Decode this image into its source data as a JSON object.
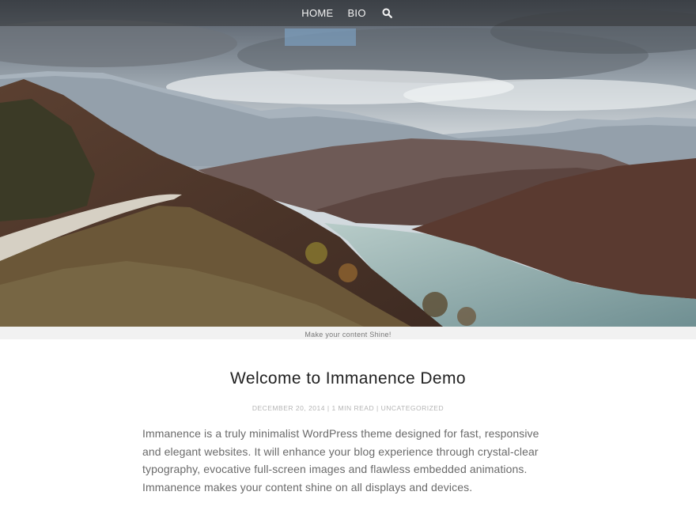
{
  "nav": {
    "items": [
      {
        "label": "HOME"
      },
      {
        "label": "BIO"
      }
    ],
    "search_icon": "search-icon"
  },
  "hero": {
    "caption": "Make your content Shine!"
  },
  "post": {
    "title": "Welcome to Immanence Demo",
    "meta": {
      "date": "DECEMBER 20, 2014",
      "read_time": "1 MIN READ",
      "category": "UNCATEGORIZED",
      "separator": "|"
    },
    "body": "Immanence is a truly minimalist WordPress theme designed for fast, responsive and elegant websites. It will enhance your blog experience through crystal-clear typography, evocative full-screen images and flawless embedded animations. Immanence makes your content shine on all displays and devices."
  },
  "colors": {
    "nav_overlay": "#282828",
    "title": "#222222",
    "meta": "#b5b5b5",
    "body_text": "#6a6a6a",
    "caption_bg": "#f1f1f1"
  }
}
